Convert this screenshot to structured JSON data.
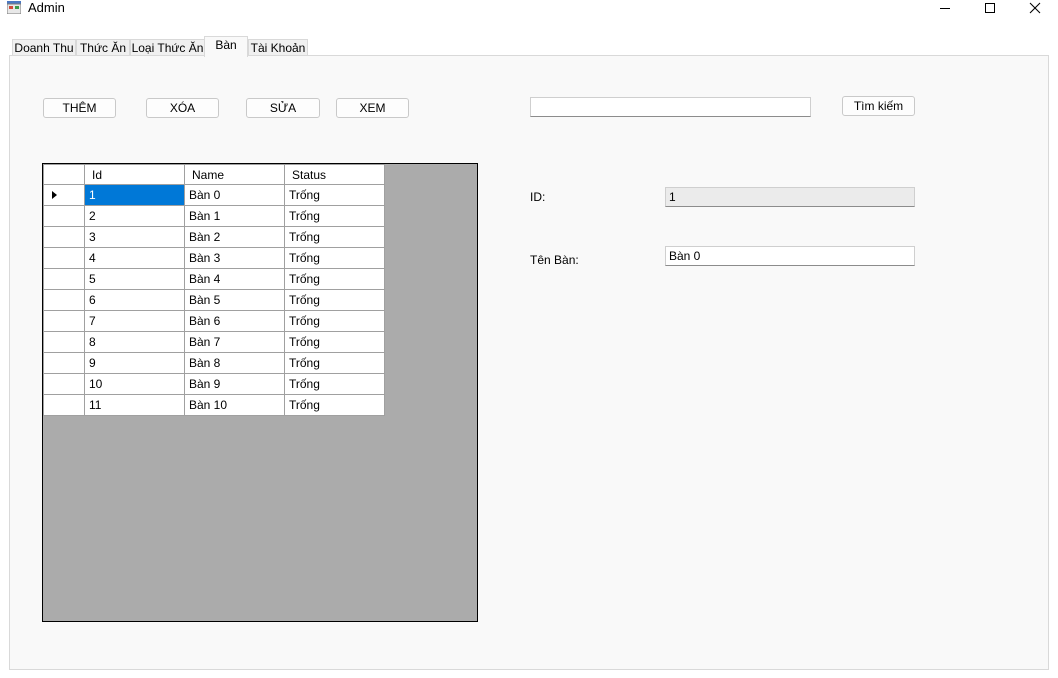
{
  "window": {
    "title": "Admin"
  },
  "tabs": [
    {
      "label": "Doanh Thu"
    },
    {
      "label": "Thức Ăn"
    },
    {
      "label": "Loại Thức Ăn"
    },
    {
      "label": "Bàn"
    },
    {
      "label": "Tài Khoản"
    }
  ],
  "toolbar": {
    "add_label": "THÊM",
    "delete_label": "XÓA",
    "edit_label": "SỬA",
    "view_label": "XEM"
  },
  "search": {
    "value": "",
    "button_label": "Tìm kiếm"
  },
  "grid": {
    "columns": [
      "Id",
      "Name",
      "Status"
    ],
    "rows": [
      {
        "id": "1",
        "name": "Bàn 0",
        "status": "Trống"
      },
      {
        "id": "2",
        "name": "Bàn 1",
        "status": "Trống"
      },
      {
        "id": "3",
        "name": "Bàn 2",
        "status": "Trống"
      },
      {
        "id": "4",
        "name": "Bàn 3",
        "status": "Trống"
      },
      {
        "id": "5",
        "name": "Bàn 4",
        "status": "Trống"
      },
      {
        "id": "6",
        "name": "Bàn 5",
        "status": "Trống"
      },
      {
        "id": "7",
        "name": "Bàn 6",
        "status": "Trống"
      },
      {
        "id": "8",
        "name": "Bàn 7",
        "status": "Trống"
      },
      {
        "id": "9",
        "name": "Bàn 8",
        "status": "Trống"
      },
      {
        "id": "10",
        "name": "Bàn 9",
        "status": "Trống"
      },
      {
        "id": "11",
        "name": "Bàn 10",
        "status": "Trống"
      }
    ]
  },
  "details": {
    "id_label": "ID:",
    "id_value": "1",
    "name_label": "Tên Bàn:",
    "name_value": "Bàn 0"
  },
  "colors": {
    "selection": "#0078d7",
    "grid_background": "#ababab"
  }
}
